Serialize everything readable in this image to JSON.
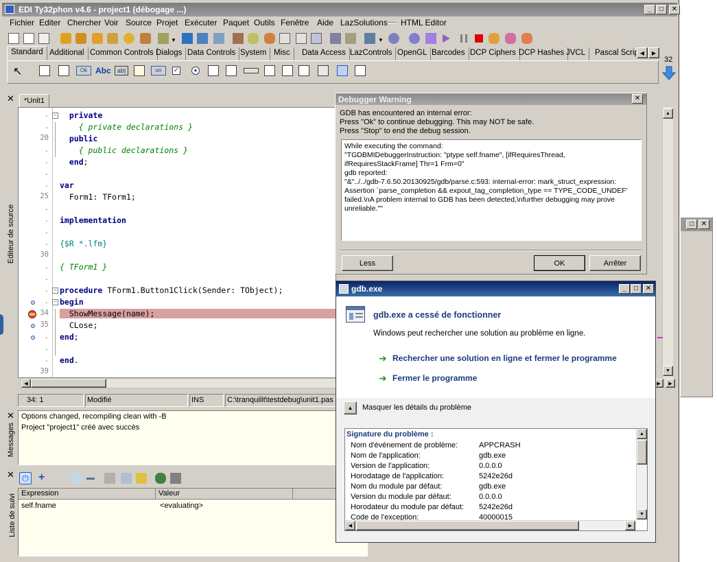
{
  "app": {
    "title": "EDI Ty32phon v4.6 - project1 (débogage ...)"
  },
  "menu": [
    "Fichier",
    "Editer",
    "Chercher",
    "Voir",
    "Source",
    "Projet",
    "Exécuter",
    "Paquet",
    "Outils",
    "Fenêtre",
    "Aide",
    "LazSolutions",
    "HTML Editor"
  ],
  "palette": {
    "tabs": [
      "Standard",
      "Additional",
      "Common Controls",
      "Dialogs",
      "Data Controls",
      "System",
      "Misc",
      "Data Access",
      "LazControls",
      "OpenGL",
      "Barcodes",
      "DCP Ciphers",
      "DCP Hashes",
      "JVCL",
      "Pascal Script"
    ],
    "active": "Standard",
    "counter": "32",
    "component_labels": [
      "Ok",
      "Abc",
      "ab|",
      "on"
    ]
  },
  "editor": {
    "tab": "*Unit1",
    "side_label": "Editeur de source",
    "line_numbers": [
      ".",
      ".",
      "20",
      ".",
      ".",
      ".",
      ".",
      "25",
      ".",
      ".",
      ".",
      ".",
      "30",
      ".",
      ".",
      ".",
      ".",
      "34",
      "35",
      ".",
      ".",
      ".",
      "39"
    ],
    "lines": [
      {
        "indent": "  ",
        "kw": "private",
        "rest": ""
      },
      {
        "indent": "    ",
        "cm": "{ private declarations }"
      },
      {
        "indent": "  ",
        "kw": "public",
        "rest": ""
      },
      {
        "indent": "    ",
        "cm": "{ public declarations }"
      },
      {
        "indent": "  ",
        "kw": "end",
        "rest": ";"
      },
      {
        "indent": "",
        "rest": ""
      },
      {
        "indent": "",
        "kw": "var",
        "rest": ""
      },
      {
        "indent": "  ",
        "rest": "Form1: TForm1;"
      },
      {
        "indent": "",
        "rest": ""
      },
      {
        "indent": "",
        "kw": "implementation",
        "rest": ""
      },
      {
        "indent": "",
        "rest": ""
      },
      {
        "indent": "",
        "dir": "{$R *.lfm}"
      },
      {
        "indent": "",
        "rest": ""
      },
      {
        "indent": "",
        "cm": "{ TForm1 }"
      },
      {
        "indent": "",
        "rest": ""
      },
      {
        "indent": "",
        "kw": "procedure",
        "rest": " TForm1.Button1Click(Sender: TObject);"
      },
      {
        "indent": "",
        "kw": "begin",
        "rest": ""
      },
      {
        "indent": "  ",
        "rest": "ShowMessage(name);"
      },
      {
        "indent": "  ",
        "rest": "CLose;"
      },
      {
        "indent": "",
        "kw": "end",
        "rest": ";"
      },
      {
        "indent": "",
        "rest": ""
      },
      {
        "indent": "",
        "kw": "end",
        "rest": "."
      },
      {
        "indent": "",
        "rest": ""
      }
    ],
    "status": {
      "position": "34:  1",
      "modified": "Modifié",
      "mode": "INS",
      "file": "C:\\tranquilit\\testdebug\\unit1.pas"
    }
  },
  "messages": {
    "side_label": "Messages",
    "lines": [
      "Options changed, recompiling clean with -B",
      "Project \"project1\" créé avec succès"
    ]
  },
  "watch": {
    "side_label": "Liste de suivi",
    "columns": [
      "Expression",
      "Valeur"
    ],
    "rows": [
      {
        "expr": "self.fname",
        "value": "<evaluating>"
      }
    ]
  },
  "debugger_warning": {
    "title": "Debugger Warning",
    "intro": [
      "GDB has encountered an internal error:",
      "Press \"Ok\" to continue debugging. This may NOT be safe.",
      "Press \"Stop\" to end the debug session."
    ],
    "details": [
      "While executing the command:",
      "\"TGDBMIDebuggerInstruction: \"ptype self.fname\", [ifRequiresThread,",
      "ifRequiresStackFrame] Thr=1 Frm=0\"",
      "gdb reported:",
      "\"&\"../../gdb-7.6.50.20130925/gdb/parse.c:593: internal-error: mark_struct_expression:",
      "Assertion `parse_completion && expout_tag_completion_type == TYPE_CODE_UNDEF'",
      "failed.\\nA problem internal to GDB has been detected,\\nfurther debugging may prove",
      "unreliable.\"\""
    ],
    "less_button": "Less",
    "ok_button": "OK",
    "stop_button": "Arrêter"
  },
  "gdb_crash": {
    "title": "gdb.exe",
    "headline": "gdb.exe a cessé de fonctionner",
    "subtext": "Windows peut rechercher une solution au problème en ligne.",
    "option1": "Rechercher une solution en ligne et fermer le programme",
    "option2": "Fermer le programme",
    "details_toggle": "Masquer les détails du problème",
    "signature_header": "Signature du problème :",
    "signature": [
      {
        "k": "Nom d'événement de problème:",
        "v": "APPCRASH"
      },
      {
        "k": "Nom de l'application:",
        "v": "gdb.exe"
      },
      {
        "k": "Version de l'application:",
        "v": "0.0.0.0"
      },
      {
        "k": "Horodatage de l'application:",
        "v": "5242e26d"
      },
      {
        "k": "Nom du module par défaut:",
        "v": "gdb.exe"
      },
      {
        "k": "Version du module par défaut:",
        "v": "0.0.0.0"
      },
      {
        "k": "Horodateur du module par défaut:",
        "v": "5242e26d"
      },
      {
        "k": "Code de l'exception:",
        "v": "40000015"
      }
    ]
  },
  "colors": {
    "face": "#d4d0c8",
    "exec_line": "#d8a0a0",
    "title_inactive": "#8a8a8a",
    "title_active": "#0a246a",
    "win7_blue": "#1c3c7c",
    "arrow_green": "#2a9a2a"
  }
}
